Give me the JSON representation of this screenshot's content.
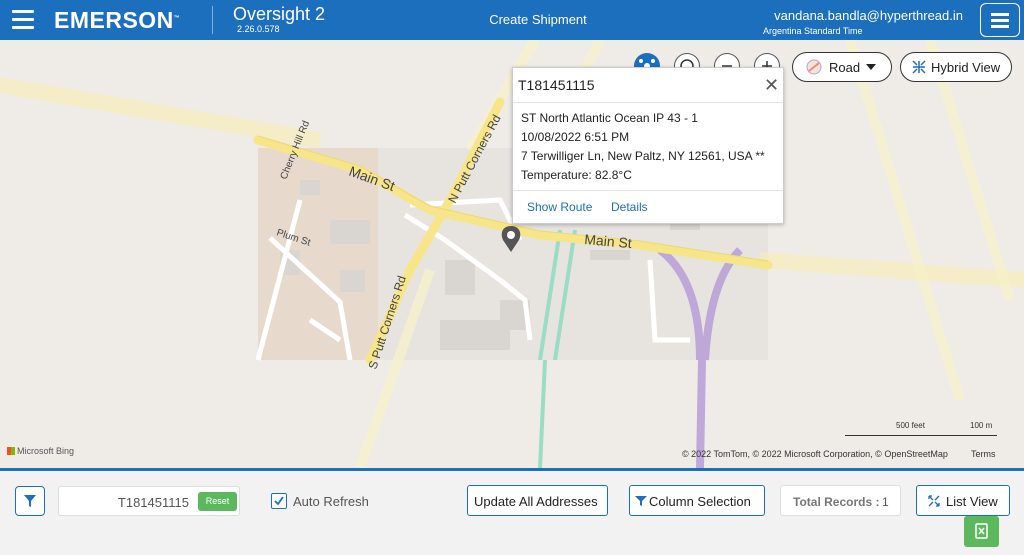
{
  "header": {
    "brand": "EMERSON",
    "brand_mark": "™",
    "app_name": "Oversight 2",
    "app_version": "2.26.0.578",
    "page_title": "Create Shipment",
    "user_email": "vandana.bandla@hyperthread.in",
    "user_timezone": "Argentina Standard Time"
  },
  "map": {
    "style_button": "Road",
    "view_button": "Hybrid View",
    "streets": [
      "Main St",
      "Main St",
      "N Putt Corners Rd",
      "S Putt Corners Rd",
      "Cherry Hill Rd",
      "Plum St"
    ],
    "popup": {
      "title": "T181451115",
      "location": "ST North Atlantic Ocean IP 43 - 1",
      "datetime": "10/08/2022 6:51 PM",
      "address": "7 Terwilliger Ln, New Paltz, NY 12561, USA **",
      "temperature": "Temperature: 82.8°C",
      "show_route": "Show Route",
      "details": "Details"
    },
    "attribution": "© 2022 TomTom, © 2022 Microsoft Corporation, © OpenStreetMap",
    "terms": "Terms",
    "bing": "Microsoft Bing",
    "scale_feet": "500 feet",
    "scale_m": "100 m"
  },
  "toolbar": {
    "search_value": "T181451115",
    "reset": "Reset",
    "auto_refresh": "Auto Refresh",
    "auto_refresh_checked": true,
    "update_addresses": "Update All Addresses",
    "column_selection": "Column Selection",
    "total_records_label": "Total Records :",
    "total_records_value": "1",
    "list_view": "List View"
  },
  "colors": {
    "primary": "#1c6fbd",
    "success": "#5cb85c",
    "road": "#f7e58a",
    "highway": "#b9a2d8"
  }
}
